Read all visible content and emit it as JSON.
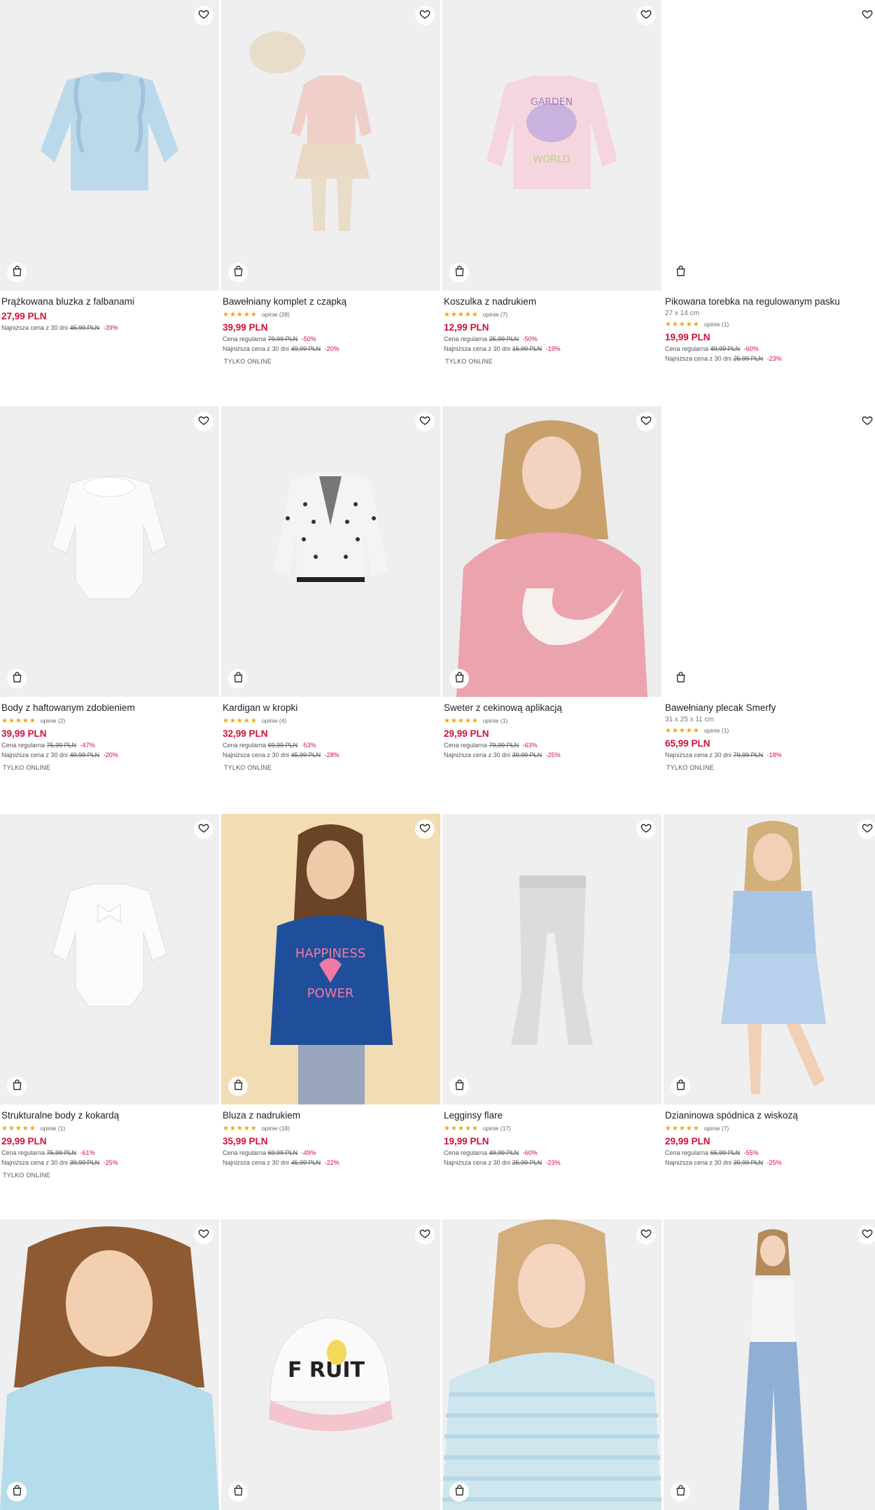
{
  "colors": {
    "price": "#d1103a",
    "stars": "#f2a700",
    "tile_bg": "#efeff0"
  },
  "icons": {
    "favorite": "heart-outline-icon",
    "cart": "shopping-bag-icon"
  },
  "products": [
    {
      "name": "Prążkowana bluzka z falbanami",
      "price": "27,99 PLN",
      "lowest_label": "Najniższa cena z 30 dni",
      "lowest_price": "45,99 PLN",
      "lowest_discount": "-39%"
    },
    {
      "name": "Bawełniany komplet z czapką",
      "stars": "★★★★★",
      "reviews": "opinie (28)",
      "price": "39,99 PLN",
      "regular_label": "Cena regularna",
      "regular_price": "79,99 PLN",
      "regular_discount": "-50%",
      "lowest_label": "Najniższa cena z 30 dni",
      "lowest_price": "49,99 PLN",
      "lowest_discount": "-20%",
      "badge": "TYLKO ONLINE"
    },
    {
      "name": "Koszulka z nadrukiem",
      "stars": "★★★★★",
      "reviews": "opinie (7)",
      "price": "12,99 PLN",
      "regular_label": "Cena regularna",
      "regular_price": "25,99 PLN",
      "regular_discount": "-50%",
      "lowest_label": "Najniższa cena z 30 dni",
      "lowest_price": "15,99 PLN",
      "lowest_discount": "-19%",
      "badge": "TYLKO ONLINE"
    },
    {
      "name": "Pikowana torebka na regulowanym pasku",
      "size": "27 x 14 cm",
      "stars": "★★★★★",
      "reviews": "opinie (1)",
      "price": "19,99 PLN",
      "regular_label": "Cena regularna",
      "regular_price": "49,99 PLN",
      "regular_discount": "-60%",
      "lowest_label": "Najniższa cena z 30 dni",
      "lowest_price": "25,99 PLN",
      "lowest_discount": "-23%"
    },
    {
      "name": "Body z haftowanym zdobieniem",
      "stars": "★★★★★",
      "reviews": "opinie (2)",
      "price": "39,99 PLN",
      "regular_label": "Cena regularna",
      "regular_price": "75,99 PLN",
      "regular_discount": "-47%",
      "lowest_label": "Najniższa cena z 30 dni",
      "lowest_price": "49,99 PLN",
      "lowest_discount": "-20%",
      "badge": "TYLKO ONLINE"
    },
    {
      "name": "Kardigan w kropki",
      "stars": "★★★★★",
      "reviews": "opinie (4)",
      "price": "32,99 PLN",
      "regular_label": "Cena regularna",
      "regular_price": "69,99 PLN",
      "regular_discount": "-53%",
      "lowest_label": "Najniższa cena z 30 dni",
      "lowest_price": "45,99 PLN",
      "lowest_discount": "-28%",
      "badge": "TYLKO ONLINE"
    },
    {
      "name": "Sweter z cekinową aplikacją",
      "stars": "★★★★★",
      "reviews": "opinie (1)",
      "price": "29,99 PLN",
      "regular_label": "Cena regularna",
      "regular_price": "79,99 PLN",
      "regular_discount": "-63%",
      "lowest_label": "Najniższa cena z 30 dni",
      "lowest_price": "39,99 PLN",
      "lowest_discount": "-25%"
    },
    {
      "name": "Bawełniany plecak Smerfy",
      "size": "31 x 25 x 11 cm",
      "stars": "★★★★★",
      "reviews": "opinie (1)",
      "price": "65,99 PLN",
      "lowest_label": "Najniższa cena z 30 dni",
      "lowest_price": "79,99 PLN",
      "lowest_discount": "-18%",
      "badge": "TYLKO ONLINE"
    },
    {
      "name": "Strukturalne body z kokardą",
      "stars": "★★★★★",
      "reviews": "opinie (1)",
      "price": "29,99 PLN",
      "regular_label": "Cena regularna",
      "regular_price": "75,99 PLN",
      "regular_discount": "-61%",
      "lowest_label": "Najniższa cena z 30 dni",
      "lowest_price": "39,99 PLN",
      "lowest_discount": "-25%",
      "badge": "TYLKO ONLINE"
    },
    {
      "name": "Bluza z nadrukiem",
      "stars": "★★★★★",
      "reviews": "opinie (18)",
      "price": "35,99 PLN",
      "regular_label": "Cena regularna",
      "regular_price": "69,99 PLN",
      "regular_discount": "-49%",
      "lowest_label": "Najniższa cena z 30 dni",
      "lowest_price": "45,99 PLN",
      "lowest_discount": "-22%"
    },
    {
      "name": "Legginsy flare",
      "stars": "★★★★★",
      "reviews": "opinie (17)",
      "price": "19,99 PLN",
      "regular_label": "Cena regularna",
      "regular_price": "49,99 PLN",
      "regular_discount": "-60%",
      "lowest_label": "Najniższa cena z 30 dni",
      "lowest_price": "25,99 PLN",
      "lowest_discount": "-23%"
    },
    {
      "name": "Dzianinowa spódnica z wiskozą",
      "stars": "★★★★★",
      "reviews": "opinie (7)",
      "price": "29,99 PLN",
      "regular_label": "Cena regularna",
      "regular_price": "65,99 PLN",
      "regular_discount": "-55%",
      "lowest_label": "Najniższa cena z 30 dni",
      "lowest_price": "39,99 PLN",
      "lowest_discount": "-25%"
    },
    {
      "name": "",
      "price": ""
    },
    {
      "name": "",
      "price": ""
    },
    {
      "name": "",
      "price": ""
    },
    {
      "name": "",
      "price": ""
    }
  ]
}
